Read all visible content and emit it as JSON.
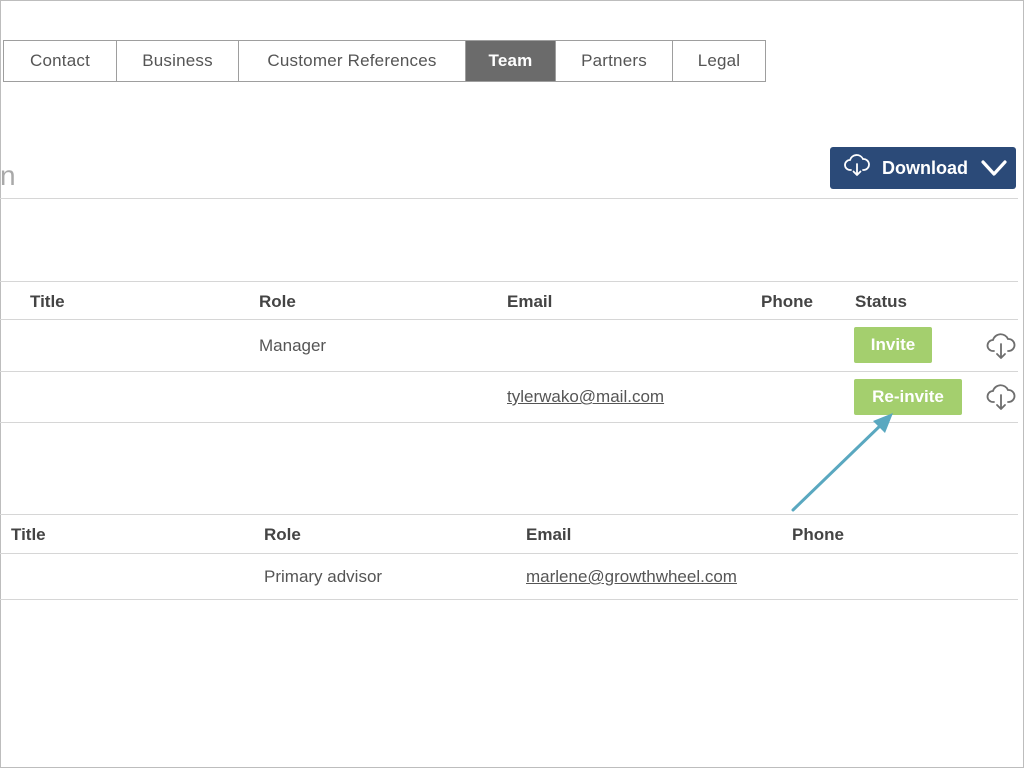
{
  "tabs": [
    {
      "label": "Contact",
      "active": false
    },
    {
      "label": "Business",
      "active": false
    },
    {
      "label": "Customer References",
      "active": false
    },
    {
      "label": "Team",
      "active": true
    },
    {
      "label": "Partners",
      "active": false
    },
    {
      "label": "Legal",
      "active": false
    }
  ],
  "section_heading_fragment": "n",
  "download": {
    "label": "Download",
    "icon": "cloud-download-icon",
    "caret": "chevron-down-icon"
  },
  "team_table": {
    "headers": {
      "title": "Title",
      "role": "Role",
      "email": "Email",
      "phone": "Phone",
      "status": "Status"
    },
    "rows": [
      {
        "title": "",
        "role": "Manager",
        "email": "",
        "phone": "",
        "status": "Invite",
        "action_icon": "cloud-download-icon"
      },
      {
        "title": "",
        "role": "",
        "email": "tylerwako@mail.com",
        "phone": "",
        "status": "Re-invite",
        "action_icon": "cloud-download-icon"
      }
    ]
  },
  "advisors_table": {
    "headers": {
      "title": "Title",
      "role": "Role",
      "email": "Email",
      "phone": "Phone"
    },
    "rows": [
      {
        "title": "",
        "role": "Primary advisor",
        "email": "marlene@growthwheel.com",
        "phone": ""
      }
    ]
  },
  "annotation": {
    "type": "arrow",
    "color": "#5aa8c0",
    "points_to": "Re-invite"
  },
  "colors": {
    "tab_active": "#6b6b6b",
    "download_bg": "#2b4a78",
    "status_button": "#a4cf6e"
  }
}
